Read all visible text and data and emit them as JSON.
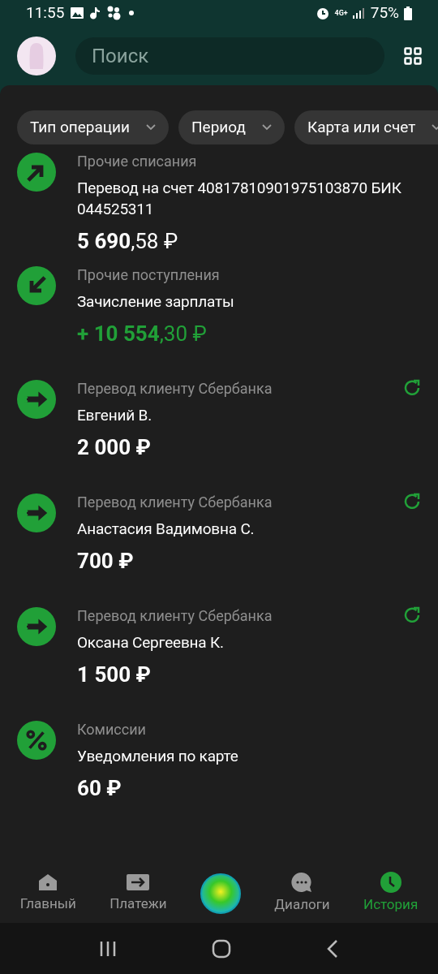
{
  "status_bar": {
    "time": "11:55",
    "network": "4G+",
    "battery": "75%"
  },
  "search": {
    "placeholder": "Поиск"
  },
  "filters": [
    {
      "label": "Тип операции"
    },
    {
      "label": "Период"
    },
    {
      "label": "Карта или счет"
    }
  ],
  "operations": [
    {
      "kind": "out",
      "category": "Прочие списания",
      "title": "Перевод на счет 40817810901975103870 БИК 044525311",
      "amount": "5 690",
      "cents": ",58 ₽",
      "income": false,
      "repeat": false
    },
    {
      "kind": "in",
      "category": "Прочие поступления",
      "title": "Зачисление зарплаты",
      "amount": "+ 10 554",
      "cents": ",30 ₽",
      "income": true,
      "repeat": false
    },
    {
      "kind": "transfer",
      "category": "Перевод клиенту Сбербанка",
      "title": "Евгений В.",
      "amount": "2 000 ₽",
      "income": false,
      "repeat": true
    },
    {
      "kind": "transfer",
      "category": "Перевод клиенту Сбербанка",
      "title": "Анастасия Вадимовна С.",
      "amount": "700 ₽",
      "income": false,
      "repeat": true
    },
    {
      "kind": "transfer",
      "category": "Перевод клиенту Сбербанка",
      "title": "Оксана Сергеевна К.",
      "amount": "1 500 ₽",
      "income": false,
      "repeat": true
    },
    {
      "kind": "percent",
      "category": "Комиссии",
      "title": "Уведомления по карте",
      "amount": "60 ₽",
      "income": false,
      "repeat": false
    }
  ],
  "bottom_nav": [
    {
      "kind": "home",
      "label": "Главный",
      "selected": false
    },
    {
      "kind": "payments",
      "label": "Платежи",
      "selected": false
    },
    {
      "kind": "assistant",
      "selected": false
    },
    {
      "kind": "dialogs",
      "label": "Диалоги",
      "selected": false
    },
    {
      "kind": "history",
      "label": "История",
      "selected": true
    }
  ]
}
